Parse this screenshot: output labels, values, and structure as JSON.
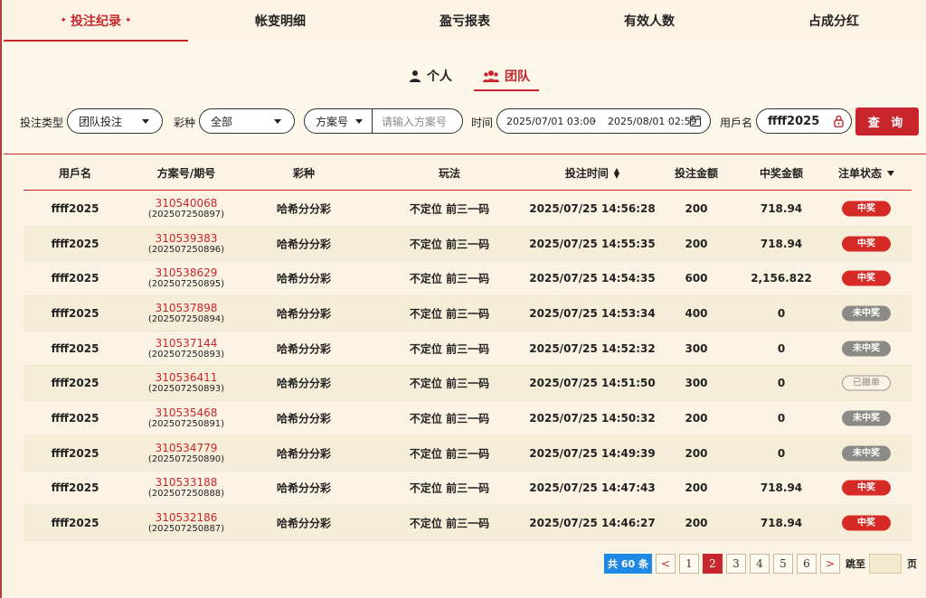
{
  "top_tabs": [
    "投注纪录",
    "帐变明细",
    "盈亏报表",
    "有效人数",
    "占成分红"
  ],
  "sub_tabs": [
    "个人",
    "团队"
  ],
  "filters": {
    "bet_type_label": "投注类型",
    "bet_type_value": "团队投注",
    "lottery_label": "彩种",
    "lottery_value": "全部",
    "scheme_select": "方案号",
    "scheme_placeholder": "请输入方案号",
    "time_label": "时间",
    "date_start": "2025/07/01 03:00",
    "date_sep": "–",
    "date_end": "2025/08/01 02:59",
    "user_label": "用戶名",
    "user_value": "ffff2025",
    "query_button": "查 询"
  },
  "columns": [
    "用戶名",
    "方案号/期号",
    "彩种",
    "玩法",
    "投注时间",
    "投注金额",
    "中奖金额",
    "注单状态"
  ],
  "rows": [
    {
      "user": "ffff2025",
      "scheme": "310540068",
      "issue": "(202507250897)",
      "lottery": "哈希分分彩",
      "play": "不定位 前三一码",
      "time": "2025/07/25 14:56:28",
      "bet": "200",
      "win": "718.94",
      "status": "中奖"
    },
    {
      "user": "ffff2025",
      "scheme": "310539383",
      "issue": "(202507250896)",
      "lottery": "哈希分分彩",
      "play": "不定位 前三一码",
      "time": "2025/07/25 14:55:35",
      "bet": "200",
      "win": "718.94",
      "status": "中奖"
    },
    {
      "user": "ffff2025",
      "scheme": "310538629",
      "issue": "(202507250895)",
      "lottery": "哈希分分彩",
      "play": "不定位 前三一码",
      "time": "2025/07/25 14:54:35",
      "bet": "600",
      "win": "2,156.822",
      "status": "中奖"
    },
    {
      "user": "ffff2025",
      "scheme": "310537898",
      "issue": "(202507250894)",
      "lottery": "哈希分分彩",
      "play": "不定位 前三一码",
      "time": "2025/07/25 14:53:34",
      "bet": "400",
      "win": "0",
      "status": "未中奖"
    },
    {
      "user": "ffff2025",
      "scheme": "310537144",
      "issue": "(202507250893)",
      "lottery": "哈希分分彩",
      "play": "不定位 前三一码",
      "time": "2025/07/25 14:52:32",
      "bet": "300",
      "win": "0",
      "status": "未中奖"
    },
    {
      "user": "ffff2025",
      "scheme": "310536411",
      "issue": "(202507250893)",
      "lottery": "哈希分分彩",
      "play": "不定位 前三一码",
      "time": "2025/07/25 14:51:50",
      "bet": "300",
      "win": "0",
      "status": "已撤单"
    },
    {
      "user": "ffff2025",
      "scheme": "310535468",
      "issue": "(202507250891)",
      "lottery": "哈希分分彩",
      "play": "不定位 前三一码",
      "time": "2025/07/25 14:50:32",
      "bet": "200",
      "win": "0",
      "status": "未中奖"
    },
    {
      "user": "ffff2025",
      "scheme": "310534779",
      "issue": "(202507250890)",
      "lottery": "哈希分分彩",
      "play": "不定位 前三一码",
      "time": "2025/07/25 14:49:39",
      "bet": "200",
      "win": "0",
      "status": "未中奖"
    },
    {
      "user": "ffff2025",
      "scheme": "310533188",
      "issue": "(202507250888)",
      "lottery": "哈希分分彩",
      "play": "不定位 前三一码",
      "time": "2025/07/25 14:47:43",
      "bet": "200",
      "win": "718.94",
      "status": "中奖"
    },
    {
      "user": "ffff2025",
      "scheme": "310532186",
      "issue": "(202507250887)",
      "lottery": "哈希分分彩",
      "play": "不定位 前三一码",
      "time": "2025/07/25 14:46:27",
      "bet": "200",
      "win": "718.94",
      "status": "中奖"
    }
  ],
  "pagination": {
    "total": "共 60 条",
    "prev": "<",
    "pages": [
      "1",
      "2",
      "3",
      "4",
      "5",
      "6"
    ],
    "current": "2",
    "next": ">",
    "jump_label": "跳至",
    "page_unit": "页"
  },
  "colors": {
    "accent": "#c8262c",
    "win_badge": "#d62a26",
    "lose_badge": "#8c8a86",
    "total_bg": "#1e88e5"
  }
}
